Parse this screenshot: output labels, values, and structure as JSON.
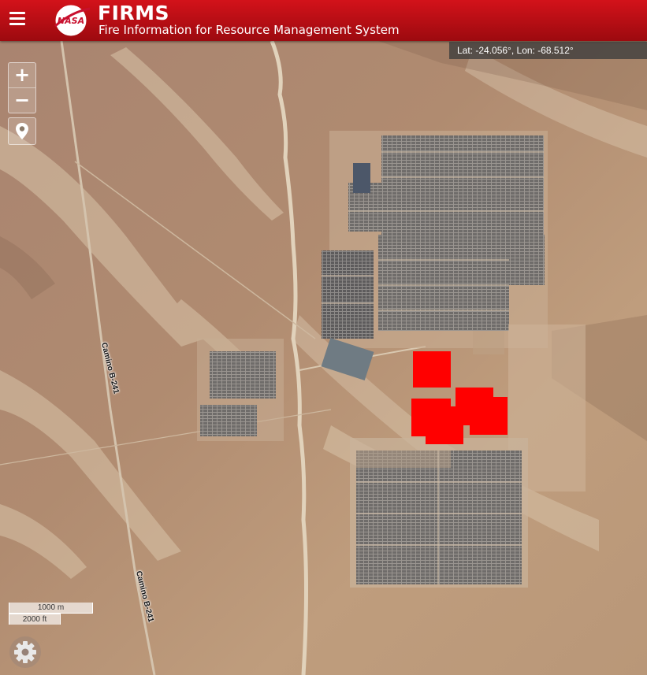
{
  "header": {
    "title": "FIRMS",
    "subtitle": "Fire Information for Resource Management System",
    "logo_text": "NASA",
    "background": "#b30d13"
  },
  "coordinate_readout": "Lat: -24.056°, Lon: -68.512°",
  "controls": {
    "zoom_in": "+",
    "zoom_out": "−",
    "locate_icon": "map-pin-icon",
    "settings_icon": "gear-icon"
  },
  "scale_bar": {
    "metric": "1000 m",
    "imperial": "2000 ft"
  },
  "road_labels": [
    "Camino B-241",
    "Camino B-241"
  ],
  "fire_marker_color": "#ff0000",
  "fire_detections_count": 5
}
